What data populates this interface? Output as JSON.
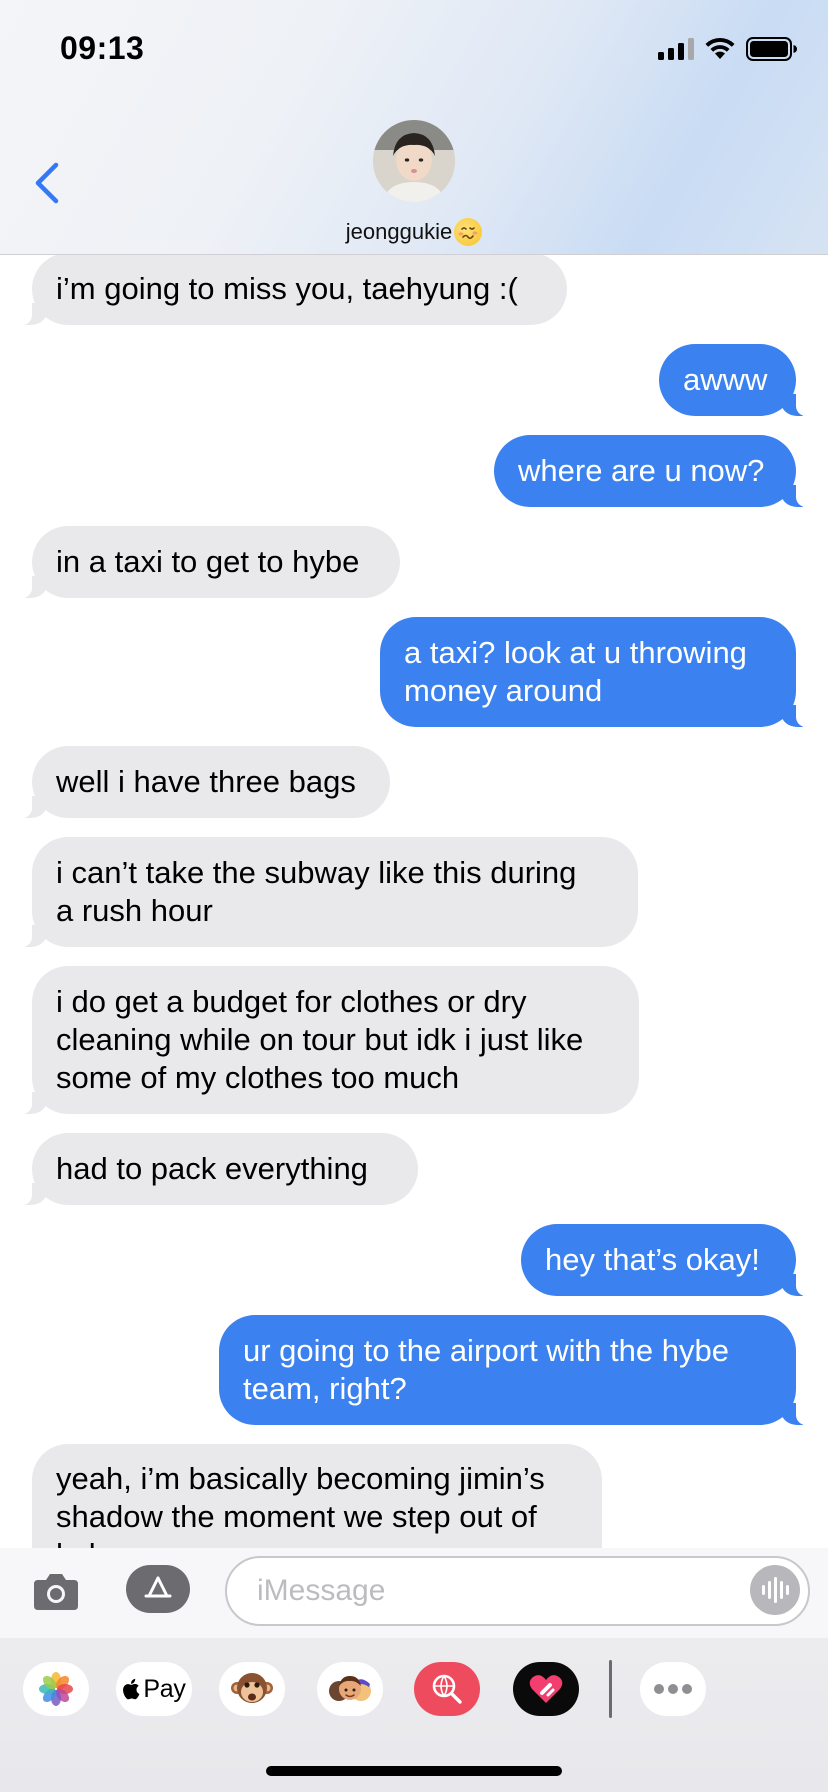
{
  "status_bar": {
    "time": "09:13"
  },
  "header": {
    "contact_name": "jeonggukie"
  },
  "messages": [
    {
      "direction": "in",
      "lines": [
        "i’m going to miss you, taehyung :("
      ]
    },
    {
      "direction": "out",
      "lines": [
        "awww"
      ]
    },
    {
      "direction": "out",
      "lines": [
        "where are u now?"
      ]
    },
    {
      "direction": "in",
      "lines": [
        "in a taxi to get to hybe"
      ]
    },
    {
      "direction": "out",
      "lines": [
        "a taxi? look at u throwing",
        "money around"
      ]
    },
    {
      "direction": "in",
      "lines": [
        "well i have three bags"
      ]
    },
    {
      "direction": "in",
      "lines": [
        "i can’t take the subway like this during",
        "a rush hour"
      ]
    },
    {
      "direction": "in",
      "lines": [
        "i do get a budget for clothes or dry",
        "cleaning while on tour but idk i just like",
        "some of my clothes too much"
      ]
    },
    {
      "direction": "in",
      "lines": [
        "had to pack everything"
      ]
    },
    {
      "direction": "out",
      "lines": [
        "hey that’s okay!"
      ]
    },
    {
      "direction": "out",
      "lines": [
        "ur going to the airport with the hybe",
        "team, right?"
      ]
    },
    {
      "direction": "in",
      "lines": [
        "yeah, i’m basically becoming jimin’s",
        "shadow the moment we step out of",
        "hybe"
      ]
    }
  ],
  "compose": {
    "placeholder": "iMessage",
    "value": ""
  },
  "app_drawer": {
    "apple_pay_label": "Pay",
    "apps": [
      "photos-app",
      "apple-pay-app",
      "monkey-memoji-app",
      "memoji-stickers-app",
      "search-images-app",
      "digital-touch-app",
      "more-apps"
    ]
  },
  "colors": {
    "outgoing_bubble": "#3b82f0",
    "incoming_bubble": "#e9e9eb",
    "ios_blue": "#3478f6"
  }
}
